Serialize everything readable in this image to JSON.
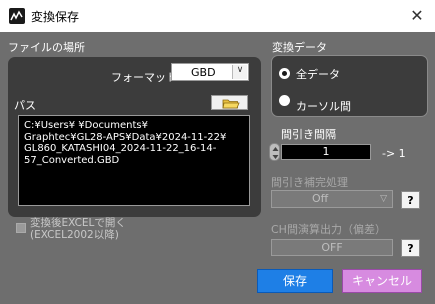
{
  "window": {
    "title": "変換保存",
    "close": "✕"
  },
  "file_location": {
    "heading": "ファイルの場所",
    "format_label": "フォーマット",
    "format_value": "GBD",
    "path_label": "パス",
    "path_lines": [
      "C:¥Users¥                    ¥Documents¥",
      "Graphtec¥GL28-APS¥Data¥2024-11-22¥",
      "GL860_KATASHI04_2024-11-22_16-14-",
      "57_Converted.GBD"
    ],
    "excel_option": [
      "変換後EXCELで開く",
      "(EXCEL2002以降)"
    ]
  },
  "convert_data": {
    "heading": "変換データ",
    "options": [
      {
        "label": "全データ",
        "selected": true
      },
      {
        "label": "カーソル間",
        "selected": false
      }
    ]
  },
  "thinning": {
    "heading": "間引き間隔",
    "value": "1",
    "result": "-> 1"
  },
  "interp": {
    "heading": "間引き補完処理",
    "value": "Off",
    "help": "?"
  },
  "ch_calc": {
    "heading": "CH間演算出力（偏差）",
    "value": "OFF",
    "help": "?"
  },
  "buttons": {
    "save": "保存",
    "cancel": "キャンセル"
  }
}
